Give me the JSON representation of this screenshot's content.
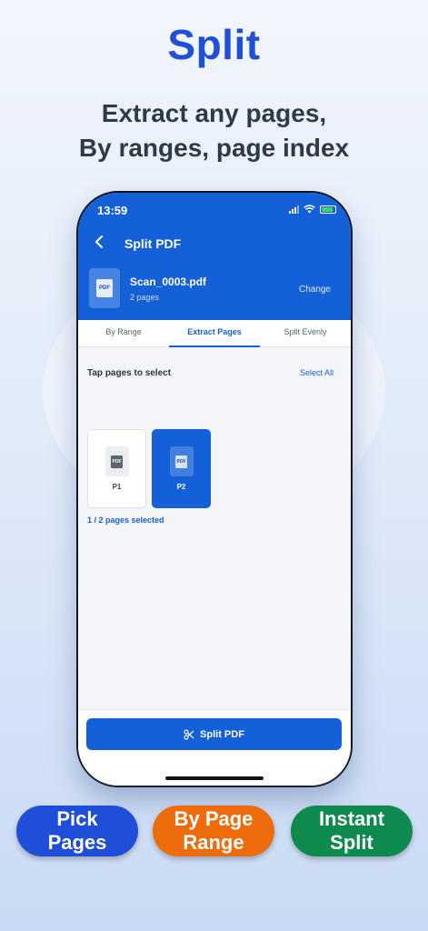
{
  "hero": {
    "title": "Split",
    "subtitle_line1": "Extract any pages,",
    "subtitle_line2": "By ranges, page index"
  },
  "status_bar": {
    "time": "13:59"
  },
  "header": {
    "back_icon": "chevron-left-icon",
    "title": "Split PDF",
    "file": {
      "name": "Scan_0003.pdf",
      "pages": "2 pages",
      "badge": "PDF"
    },
    "change_label": "Change"
  },
  "tabs": [
    {
      "label": "By Range",
      "active": false
    },
    {
      "label": "Extract Pages",
      "active": true
    },
    {
      "label": "Split Evenly",
      "active": false
    }
  ],
  "content": {
    "instruction": "Tap pages to select",
    "select_all": "Select All",
    "pages": [
      {
        "label": "P1",
        "badge": "PDF",
        "selected": false
      },
      {
        "label": "P2",
        "badge": "PDF",
        "selected": true
      }
    ],
    "selection_status": "1 / 2 pages selected"
  },
  "footer": {
    "button_label": "Split PDF",
    "button_icon": "scissors-icon"
  },
  "features": [
    {
      "line1": "Pick",
      "line2": "Pages",
      "color": "#1f4fd8"
    },
    {
      "line1": "By Page",
      "line2": "Range",
      "color": "#ee6c0c"
    },
    {
      "line1": "Instant",
      "line2": "Split",
      "color": "#0f8a4f"
    }
  ],
  "colors": {
    "accent": "#1460d8",
    "hero_title": "#1f4fd8"
  }
}
